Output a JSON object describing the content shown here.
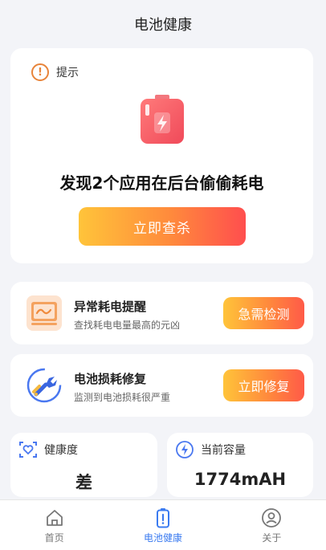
{
  "header": {
    "title": "电池健康"
  },
  "hero": {
    "tip_label": "提示",
    "tip_icon_glyph": "!",
    "tip_color": "#e8843a",
    "title": "发现2个应用在后台偷偷耗电",
    "button_label": "立即查杀"
  },
  "features": [
    {
      "title": "异常耗电提醒",
      "subtitle": "查找耗电电量最高的元凶",
      "button_label": "急需检测",
      "icon": "monitor-icon"
    },
    {
      "title": "电池损耗修复",
      "subtitle": "监测到电池损耗很严重",
      "button_label": "立即修复",
      "icon": "wrench-icon"
    }
  ],
  "stats": [
    {
      "label": "健康度",
      "value": "差",
      "icon": "heart-shield-icon"
    },
    {
      "label": "当前容量",
      "value": "1774mAH",
      "icon": "lightning-circle-icon"
    }
  ],
  "tabs": [
    {
      "label": "首页",
      "icon": "home-icon",
      "active": false
    },
    {
      "label": "电池健康",
      "icon": "battery-icon",
      "active": true
    },
    {
      "label": "关于",
      "icon": "user-icon",
      "active": false
    }
  ],
  "colors": {
    "accent_blue": "#3b7bf0",
    "button_gradient_start": "#ffc43a",
    "button_gradient_end": "#ff4e4e"
  }
}
